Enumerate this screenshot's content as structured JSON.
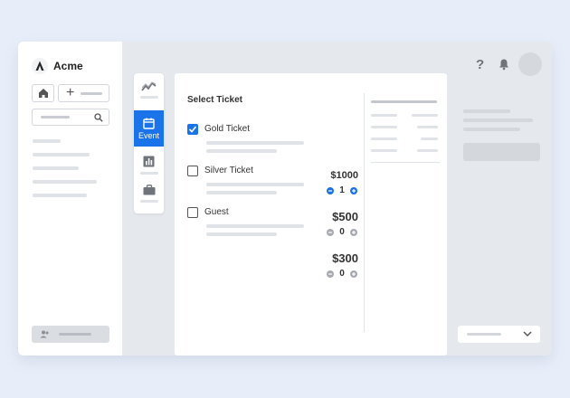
{
  "app": {
    "name": "Acme"
  },
  "rail": {
    "active_label": "Event"
  },
  "panel": {
    "title": "Select Ticket",
    "tickets": [
      {
        "name": "Gold Ticket",
        "price": "$1000",
        "quantity": "1",
        "checked": true
      },
      {
        "name": "Silver Ticket",
        "price": "$500",
        "quantity": "0",
        "checked": false
      },
      {
        "name": "Guest",
        "price": "$300",
        "quantity": "0",
        "checked": false
      }
    ]
  },
  "topbar": {
    "help_glyph": "?"
  },
  "colors": {
    "accent": "#1a73e8",
    "background": "#e8eef9"
  },
  "icons": [
    "logo-icon",
    "home-icon",
    "plus-icon",
    "search-icon",
    "help-icon",
    "bell-icon",
    "analytics-icon",
    "calendar-icon",
    "bar-chart-icon",
    "briefcase-icon",
    "users-icon",
    "chevron-down-icon",
    "check-icon",
    "minus-icon"
  ]
}
